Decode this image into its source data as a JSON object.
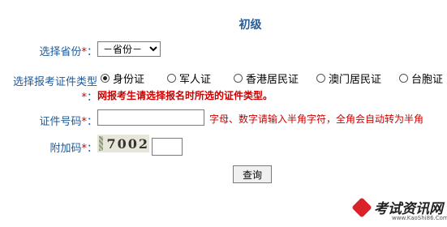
{
  "title": "初级",
  "form": {
    "province_label": "选择省份",
    "province_star": "*",
    "province_selected": "－省份－",
    "id_type_label": "选择报考证件类型",
    "id_type_star": "*",
    "id_types": [
      "身份证",
      "军人证",
      "香港居民证",
      "澳门居民证",
      "台胞证"
    ],
    "id_type_selected_index": 0,
    "warning": "网报考生请选择报名时所选的证件类型。",
    "id_number_label": "证件号码",
    "id_number_star": "*",
    "id_number_value": "",
    "id_number_hint": "字母、数字请输入半角字符，全角会自动转为半角",
    "captcha_label": "附加码",
    "captcha_star": "*",
    "captcha_code": "7002",
    "captcha_value": "",
    "submit_label": "查询"
  },
  "watermark": {
    "text": "考试资讯网",
    "url": "www.KaoShi86.Com"
  }
}
